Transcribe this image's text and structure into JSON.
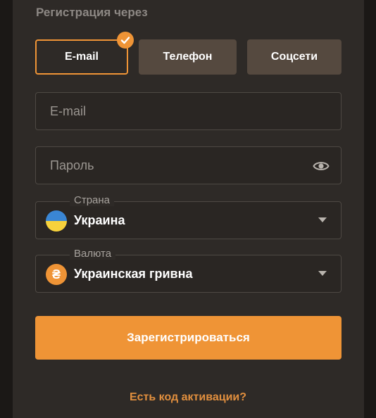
{
  "header": {
    "title": "Регистрация через"
  },
  "tabs": [
    {
      "label": "E-mail",
      "active": true
    },
    {
      "label": "Телефон",
      "active": false
    },
    {
      "label": "Соцсети",
      "active": false
    }
  ],
  "form": {
    "email_placeholder": "E-mail",
    "password_placeholder": "Пароль",
    "country": {
      "legend": "Страна",
      "value": "Украина"
    },
    "currency": {
      "legend": "Валюта",
      "value": "Украинская гривна",
      "symbol": "₴"
    }
  },
  "submit_label": "Зарегистрироваться",
  "activation_link": "Есть код активации?",
  "colors": {
    "accent": "#ef9436",
    "panel": "#2e2a27",
    "tab_inactive": "#55493f"
  },
  "icons": [
    "check-icon",
    "eye-icon",
    "ukraine-flag-icon",
    "hryvnia-icon",
    "chevron-down-icon"
  ]
}
